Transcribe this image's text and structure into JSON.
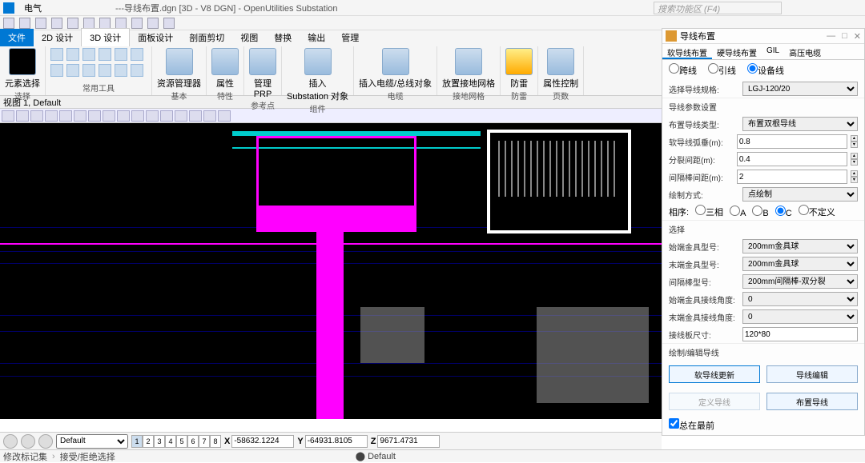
{
  "menubar": {
    "app": "电气",
    "title": "---导线布置.dgn [3D - V8 DGN] - OpenUtilities Substation",
    "search_ph": "搜索功能区 (F4)"
  },
  "tabs": {
    "file": "文件",
    "t1": "2D 设计",
    "t2": "3D 设计",
    "t3": "面板设计",
    "t4": "剖面剪切",
    "t5": "视图",
    "t6": "替换",
    "t7": "输出",
    "t8": "管理"
  },
  "rg": {
    "select": "元素选择",
    "sel": "选择",
    "tools": "常用工具",
    "basic": "基本",
    "attr": "属性",
    "attrg": "特性",
    "mgr": "资源管理器",
    "prp": "管理\nPRP",
    "ref": "参考点",
    "ins": "插入\nSubstation 对象",
    "comp": "组件",
    "cable": "插入电缆/总线对象",
    "cableg": "电缆",
    "grid": "放置接地网格",
    "gridg": "接地网格",
    "light": "防雷",
    "lightg": "防雷",
    "ctrl": "属性控制",
    "page": "页数"
  },
  "viewbar": "视图 1, Default",
  "panel": {
    "title": "导线布置",
    "tabs": {
      "t1": "软导线布置",
      "t2": "硬导线布置",
      "t3": "GIL",
      "t4": "高压电缆"
    },
    "radios": {
      "r1": "跨线",
      "r2": "引线",
      "r3": "设备线"
    },
    "lbl_spec": "选择导线规格:",
    "val_spec": "LGJ-120/20",
    "lbl_param": "导线参数设置",
    "lbl_type": "布置导线类型:",
    "val_type": "布置双根导线",
    "lbl_sag": "软导线弧垂(m):",
    "val_sag": "0.8",
    "lbl_split": "分裂间距(m):",
    "val_split": "0.4",
    "lbl_bar": "间隔棒间距(m):",
    "val_bar": "2",
    "lbl_draw": "绘制方式:",
    "val_draw": "点绘制",
    "lbl_phase": "相序:",
    "ph1": "三相",
    "ph2": "A",
    "ph3": "B",
    "ph4": "C",
    "ph5": "不定义",
    "sel_hdr": "选择",
    "lbl_start": "始端金具型号:",
    "val_start": "200mm金具球",
    "lbl_end": "末端金具型号:",
    "val_end": "200mm金具球",
    "lbl_barmodel": "间隔棒型号:",
    "val_barmodel": "200mm间隔棒-双分裂",
    "lbl_sa": "始端金具接线角度:",
    "val_sa": "0",
    "lbl_ea": "末端金具接线角度:",
    "val_ea": "0",
    "lbl_plate": "接线板尺寸:",
    "val_plate": "120*80",
    "sect_edit": "绘制/编辑导线",
    "btn_update": "软导线更新",
    "btn_edit": "导线编辑",
    "btn_define": "定义导线",
    "btn_layout": "布置导线",
    "chk": "总在最前"
  },
  "status": {
    "def": "Default",
    "pages": [
      "1",
      "2",
      "3",
      "4",
      "5",
      "6",
      "7",
      "8"
    ],
    "x": "-58632.1224",
    "y": "-64931.8105",
    "z": "9671.4731"
  },
  "status2": {
    "l": "修改标记集",
    "r": "接受/拒绝选择",
    "def": "Default"
  }
}
